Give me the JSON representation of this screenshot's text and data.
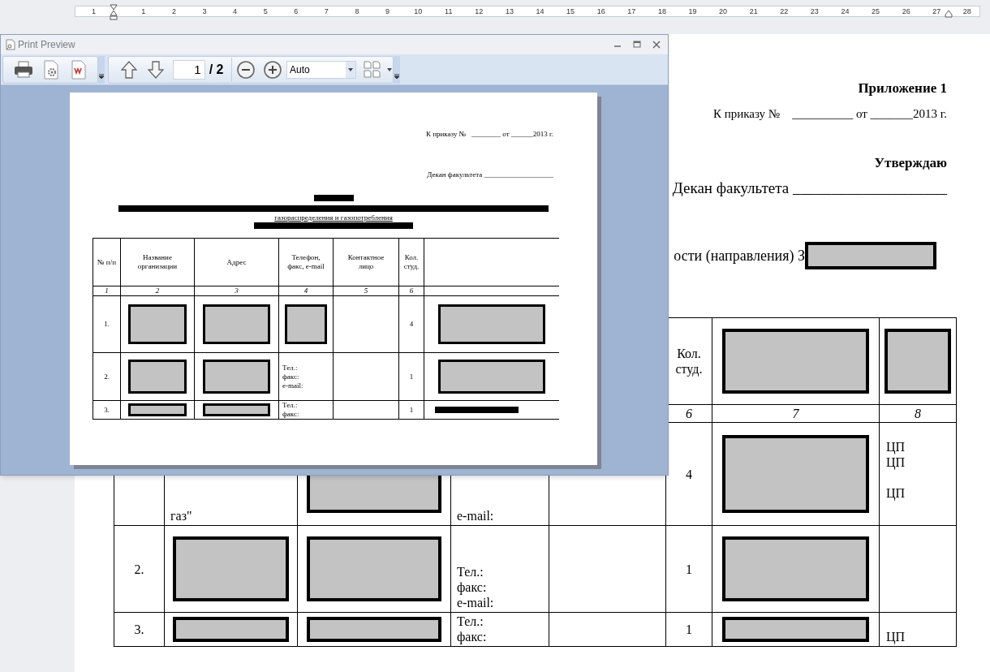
{
  "ruler": {
    "marks": [
      "1",
      "1",
      "2",
      "3",
      "4",
      "5",
      "6",
      "7",
      "8",
      "9",
      "10",
      "11",
      "12",
      "13",
      "14",
      "15",
      "16",
      "17",
      "18",
      "19",
      "20",
      "21",
      "22",
      "23",
      "24",
      "25",
      "26",
      "27",
      "28"
    ]
  },
  "document": {
    "appendix": "Приложение 1",
    "order_line": "К приказу №    __________ от _______2013 г.",
    "approve": "Утверждаю",
    "dean": "Декан факультета ____________________",
    "speciality": "ости (направления) З",
    "table": {
      "rows": [
        {
          "kind": "header",
          "cells": [
            {
              "kind": "empty"
            },
            {
              "kind": "empty"
            },
            {
              "kind": "empty"
            },
            {
              "kind": "empty"
            },
            {
              "kind": "empty"
            },
            "Кол.\nстуд.",
            {
              "kind": "redaction"
            },
            {
              "kind": "redaction"
            }
          ]
        },
        {
          "kind": "numbers",
          "cells": [
            {
              "kind": "empty"
            },
            {
              "kind": "empty"
            },
            {
              "kind": "empty"
            },
            {
              "kind": "empty"
            },
            {
              "kind": "empty"
            },
            "6",
            "7",
            "8"
          ]
        },
        {
          "kind": "body",
          "cells": [
            {
              "kind": "empty"
            },
            "газ\"",
            {
              "kind": "redaction"
            },
            "e-mail:",
            {
              "kind": "empty"
            },
            "4",
            {
              "kind": "redaction"
            },
            "ЦП\nЦП\n\nЦП"
          ]
        },
        {
          "kind": "body",
          "cells": [
            "2.",
            {
              "kind": "redaction"
            },
            {
              "kind": "redaction"
            },
            "Тел.:\nфакс:\ne-mail:",
            {
              "kind": "empty"
            },
            "1",
            {
              "kind": "redaction"
            },
            {
              "kind": "empty"
            }
          ]
        },
        {
          "kind": "body",
          "cells": [
            "3.",
            {
              "kind": "redaction"
            },
            {
              "kind": "redaction"
            },
            "Тел.:\nфакс:",
            {
              "kind": "empty"
            },
            "1",
            {
              "kind": "redaction"
            },
            "ЦП"
          ]
        }
      ]
    }
  },
  "preview": {
    "title": "Print Preview",
    "page_field": "1",
    "page_total": "/ 2",
    "zoom_combo": "Auto",
    "page": {
      "order_line": "К приказу №   ________ от ______2013 г.",
      "dean": "Декан факультета ___________________",
      "subtitle": "газораспределения и газопотребления",
      "table": {
        "rows": [
          {
            "kind": "header",
            "cells": [
              "№ п/п",
              "Название\nорганизации",
              "Адрес",
              "Телефон,\nфакс, e-mail",
              "Контактное\nлицо",
              "Кол.\nстуд.",
              {
                "kind": "empty"
              }
            ]
          },
          {
            "kind": "numbers",
            "cells": [
              "1",
              "2",
              "3",
              "4",
              "5",
              "6",
              {
                "kind": "empty"
              }
            ]
          },
          {
            "kind": "body",
            "cells": [
              "1.",
              {
                "kind": "redaction"
              },
              {
                "kind": "redaction"
              },
              {
                "kind": "redaction"
              },
              {
                "kind": "empty"
              },
              "4",
              {
                "kind": "redaction"
              }
            ]
          },
          {
            "kind": "body",
            "cells": [
              "2.",
              {
                "kind": "redaction"
              },
              {
                "kind": "redaction"
              },
              "Тел.:\nфакс:\ne-mail:",
              {
                "kind": "empty"
              },
              "1",
              {
                "kind": "redaction"
              }
            ]
          },
          {
            "kind": "body",
            "cells": [
              "3.",
              {
                "kind": "redaction"
              },
              {
                "kind": "redaction"
              },
              "Тел.:\nфакс:",
              {
                "kind": "empty"
              },
              "1",
              {
                "kind": "blackout"
              }
            ]
          }
        ]
      }
    }
  }
}
